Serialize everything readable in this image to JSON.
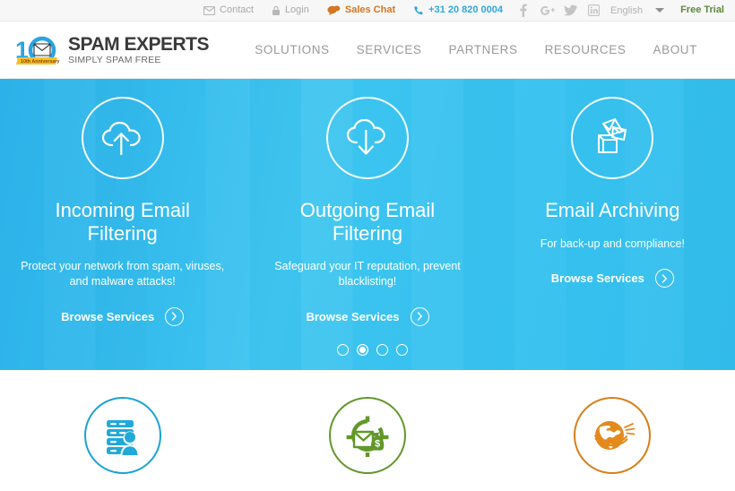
{
  "topbar": {
    "links": [
      {
        "label": "Contact",
        "icon": "envelope-icon",
        "style": "grey"
      },
      {
        "label": "Login",
        "icon": "lock-icon",
        "style": "grey"
      },
      {
        "label": "Sales Chat",
        "icon": "chat-bubble-icon",
        "style": "orange"
      },
      {
        "label": "+31 20 820 0004",
        "icon": "phone-icon",
        "style": "blue"
      }
    ],
    "social": [
      {
        "name": "facebook-icon",
        "glyph": "f"
      },
      {
        "name": "google-plus-icon",
        "glyph": "g+"
      },
      {
        "name": "twitter-icon",
        "glyph": "t"
      },
      {
        "name": "linkedin-icon",
        "glyph": "in"
      }
    ],
    "language": "English",
    "free_trial": "Free Trial"
  },
  "header": {
    "logo": {
      "badge_number": "10",
      "badge_ribbon": "10th Anniversary",
      "title": "SPAM EXPERTS",
      "subtitle": "SIMPLY SPAM FREE"
    },
    "nav": [
      {
        "label": "SOLUTIONS"
      },
      {
        "label": "SERVICES"
      },
      {
        "label": "PARTNERS"
      },
      {
        "label": "RESOURCES"
      },
      {
        "label": "ABOUT"
      }
    ]
  },
  "hero": {
    "slides": [
      {
        "icon": "cloud-upload-icon",
        "heading": "Incoming Email Filtering",
        "description": "Protect your network from spam, viruses, and malware attacks!",
        "cta": "Browse Services"
      },
      {
        "icon": "cloud-download-icon",
        "heading": "Outgoing Email Filtering",
        "description": "Safeguard your IT reputation, prevent blacklisting!",
        "cta": "Browse Services"
      },
      {
        "icon": "archive-box-icon",
        "heading": "Email Archiving",
        "description": "For back-up and compliance!",
        "cta": "Browse Services"
      }
    ],
    "carousel": {
      "total": 4,
      "active_index": 1
    },
    "colors": {
      "gradient_start": "#2cb2e8",
      "gradient_end": "#3ec5f0"
    }
  },
  "features": [
    {
      "icon": "server-user-icon",
      "color": "#1aa3d4"
    },
    {
      "icon": "recycle-mail-money-icon",
      "color": "#63972a"
    },
    {
      "icon": "globe-orbit-icon",
      "color": "#d97e15"
    }
  ]
}
